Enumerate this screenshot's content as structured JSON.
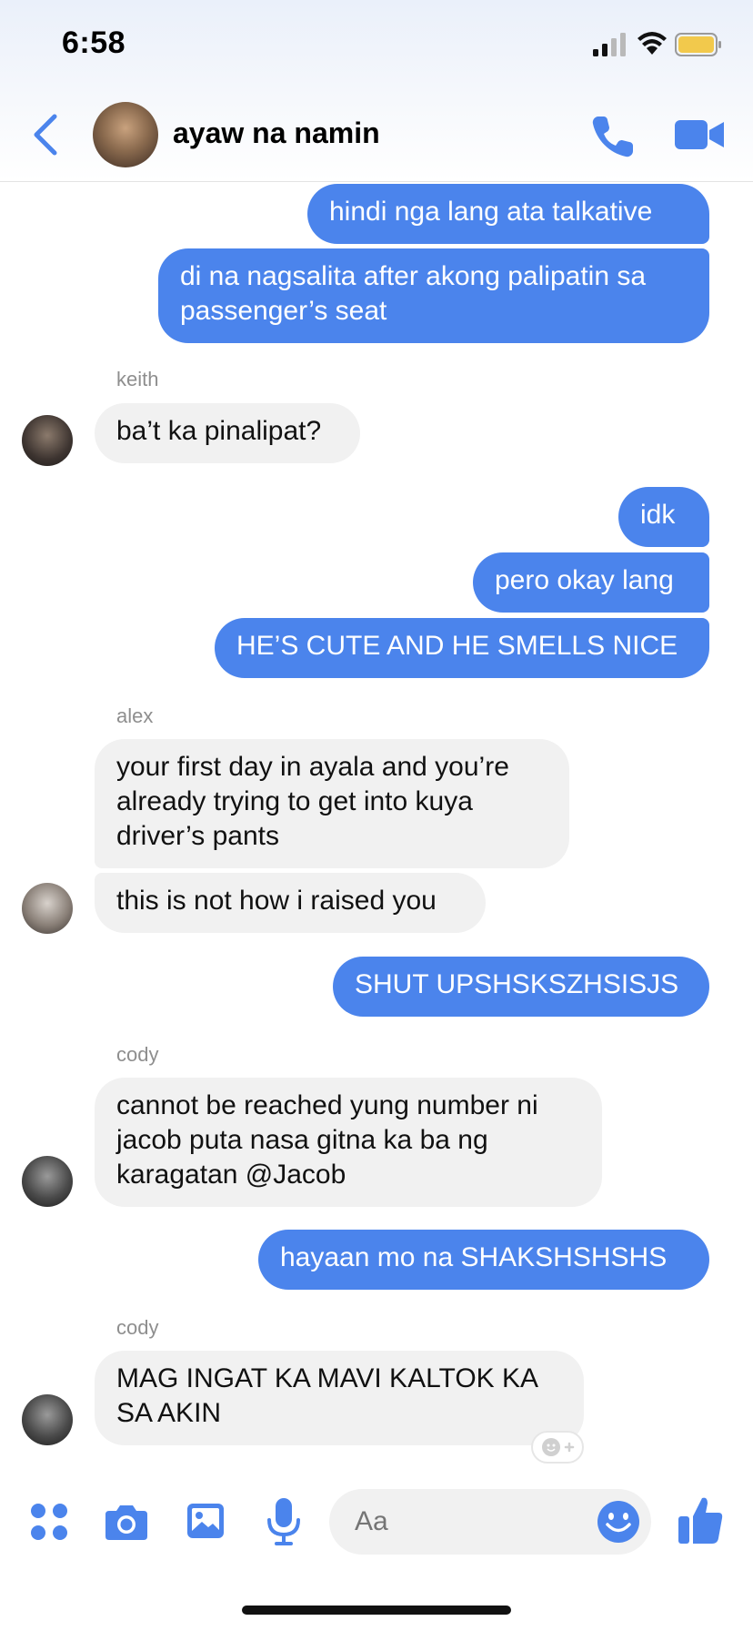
{
  "status": {
    "time": "6:58"
  },
  "header": {
    "title": "ayaw na namin"
  },
  "messages": {
    "m1": "hindi nga lang ata talkative",
    "m2": "di na nagsalita after akong palipatin sa passenger’s seat",
    "keith_name": "keith",
    "m3": "ba’t ka pinalipat?",
    "m4": "idk",
    "m5": "pero okay lang",
    "m6": "HE’S CUTE AND HE SMELLS NICE",
    "alex_name": "alex",
    "m7": "your first day in ayala and you’re already trying to get into kuya driver’s pants",
    "m8": "this is not how i raised you",
    "m9": "SHUT UPSHSKSZHSISJS",
    "cody_name1": "cody",
    "m10": "cannot be reached yung number ni jacob puta nasa gitna ka ba ng karagatan @Jacob",
    "m11": "hayaan mo na SHAKSHSHSHS",
    "cody_name2": "cody",
    "m12": "MAG INGAT KA MAVI KALTOK KA SA AKIN"
  },
  "composer": {
    "placeholder": "Aa"
  },
  "colors": {
    "accent": "#4b84ec",
    "incoming": "#f1f1f1"
  }
}
